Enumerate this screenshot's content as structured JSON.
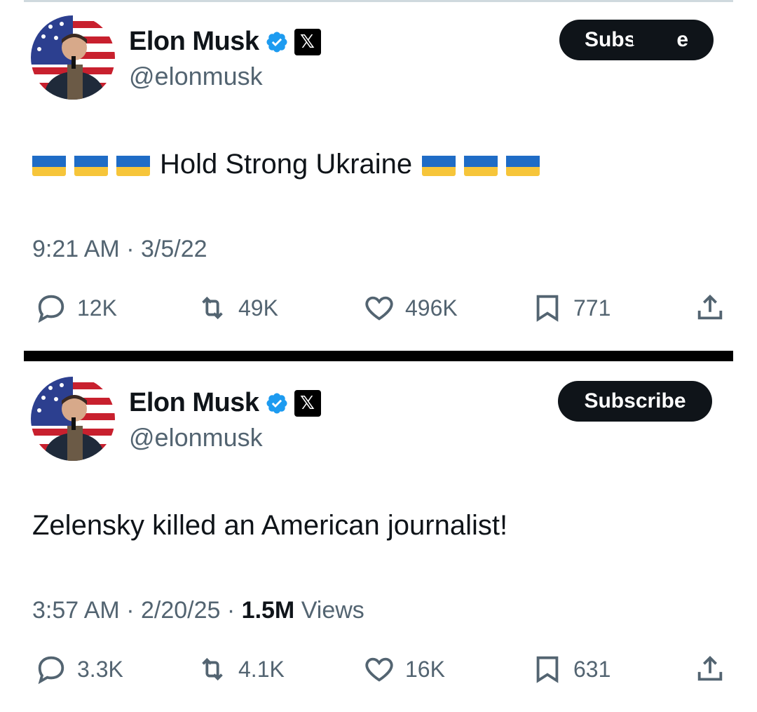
{
  "tweets": [
    {
      "author": {
        "name": "Elon Musk",
        "handle": "@elonmusk",
        "subscribe_label": "Subs",
        "subscribe_tail": "e"
      },
      "text": "Hold Strong Ukraine",
      "flags_before": 3,
      "flags_after": 3,
      "time": "9:21 AM",
      "date": "3/5/22",
      "stats": {
        "replies": "12K",
        "reposts": "49K",
        "likes": "496K",
        "bookmarks": "771"
      }
    },
    {
      "author": {
        "name": "Elon Musk",
        "handle": "@elonmusk",
        "subscribe_label": "Subscribe"
      },
      "text": "Zelensky killed an American journalist!",
      "time": "3:57 AM",
      "date": "2/20/25",
      "views_count": "1.5M",
      "views_label": "Views",
      "stats": {
        "replies": "3.3K",
        "reposts": "4.1K",
        "likes": "16K",
        "bookmarks": "631"
      }
    }
  ],
  "separator": "·",
  "colors": {
    "text": "#0f1419",
    "muted": "#536471",
    "verified": "#1d9bf0",
    "flag_blue": "#1f6cc6",
    "flag_yellow": "#f6c53a"
  },
  "icons": [
    "reply-icon",
    "retweet-icon",
    "heart-icon",
    "bookmark-icon",
    "share-icon",
    "verified-badge-icon",
    "x-logo-icon"
  ]
}
